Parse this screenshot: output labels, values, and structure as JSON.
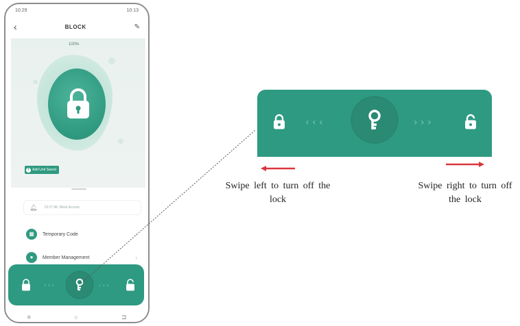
{
  "status_bar": {
    "time_left": "10:29",
    "time_right": "10:13"
  },
  "header": {
    "title": "BLOCK"
  },
  "lock_status": {
    "battery": "100%"
  },
  "add_badge": {
    "label": "Add Unit Saved"
  },
  "record": {
    "text": "13:27 Mr. Mock Access"
  },
  "menu": [
    {
      "label": "Temporary Code"
    },
    {
      "label": "Member Management"
    }
  ],
  "captions": {
    "left": "Swipe left to turn off the lock",
    "right": "Swipe right to turn off the lock"
  },
  "colors": {
    "accent": "#2e9a82",
    "arrow": "#d9363e"
  },
  "icons": [
    "lock-icon",
    "unlock-icon",
    "key-icon",
    "bell-icon",
    "code-icon",
    "person-icon",
    "back-icon",
    "edit-icon"
  ]
}
